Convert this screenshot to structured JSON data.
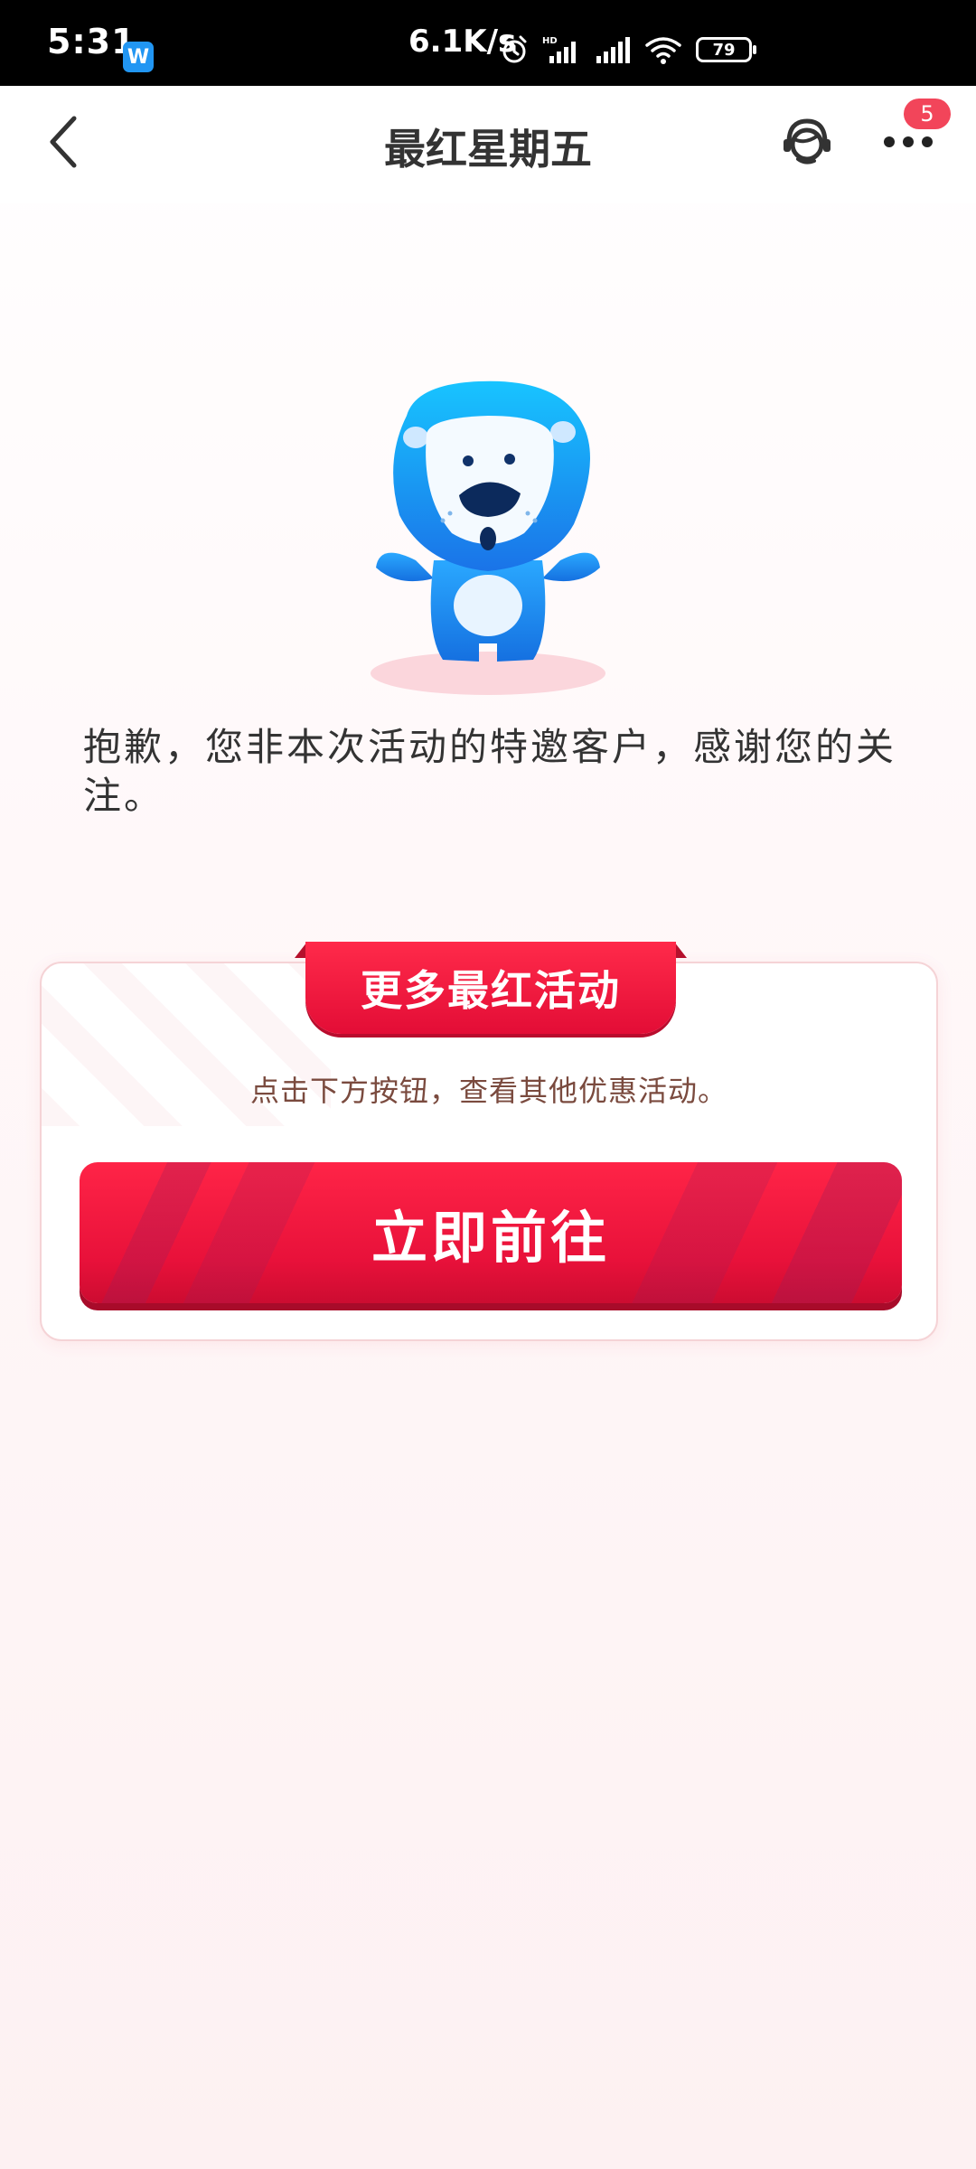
{
  "status_bar": {
    "time": "5:31",
    "app_icon_letter": "W",
    "net_speed": "6.1K/s",
    "icons": [
      "alarm-icon",
      "hd-signal-icon",
      "signal-icon",
      "wifi-icon",
      "battery-icon"
    ],
    "hd_label": "HD",
    "battery_level": "79"
  },
  "nav": {
    "title": "最红星期五",
    "badge_count": "5",
    "icons": [
      "back-chevron-icon",
      "customer-service-icon",
      "more-dots-icon"
    ]
  },
  "message": "抱歉，您非本次活动的特邀客户，感谢您的关注。",
  "card": {
    "ribbon_title": "更多最红活动",
    "description": "点击下方按钮，查看其他优惠活动。",
    "button_label": "立即前往"
  },
  "colors": {
    "accent_red": "#e8113a",
    "badge_red": "#f2455a",
    "mascot_blue": "#1a9bf5"
  }
}
